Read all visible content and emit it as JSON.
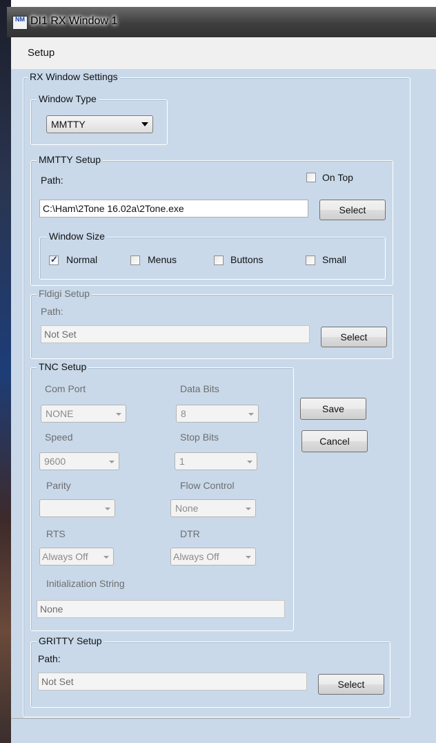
{
  "window": {
    "title": "DI1 RX Window 1",
    "icon_text": "NM"
  },
  "menu": {
    "setup_label": "Setup"
  },
  "rx_settings": {
    "legend": "RX Window Settings"
  },
  "window_type": {
    "legend": "Window Type",
    "selected": "MMTTY"
  },
  "mmtty_setup": {
    "legend": "MMTTY Setup",
    "path_label": "Path:",
    "on_top_label": "On Top",
    "on_top_checked": false,
    "path_value": "C:\\Ham\\2Tone 16.02a\\2Tone.exe",
    "select_label": "Select",
    "window_size": {
      "legend": "Window Size",
      "normal_label": "Normal",
      "normal_checked": true,
      "menus_label": "Menus",
      "menus_checked": false,
      "buttons_label": "Buttons",
      "buttons_checked": false,
      "small_label": "Small",
      "small_checked": false
    }
  },
  "fldigi_setup": {
    "legend": "Fldigi Setup",
    "path_label": "Path:",
    "path_value": "Not Set",
    "select_label": "Select"
  },
  "tnc_setup": {
    "legend": "TNC Setup",
    "com_port_label": "Com Port",
    "com_port_value": "NONE",
    "data_bits_label": "Data Bits",
    "data_bits_value": "8",
    "speed_label": "Speed",
    "speed_value": "9600",
    "stop_bits_label": "Stop Bits",
    "stop_bits_value": "1",
    "parity_label": "Parity",
    "parity_value": "",
    "flow_control_label": "Flow Control",
    "flow_control_value": "None",
    "rts_label": "RTS",
    "rts_value": "Always Off",
    "dtr_label": "DTR",
    "dtr_value": "Always Off",
    "init_string_label": "Initialization String",
    "init_string_value": "None"
  },
  "actions": {
    "save_label": "Save",
    "cancel_label": "Cancel"
  },
  "gritty_setup": {
    "legend": "GRITTY Setup",
    "path_label": "Path:",
    "path_value": "Not Set",
    "select_label": "Select"
  }
}
